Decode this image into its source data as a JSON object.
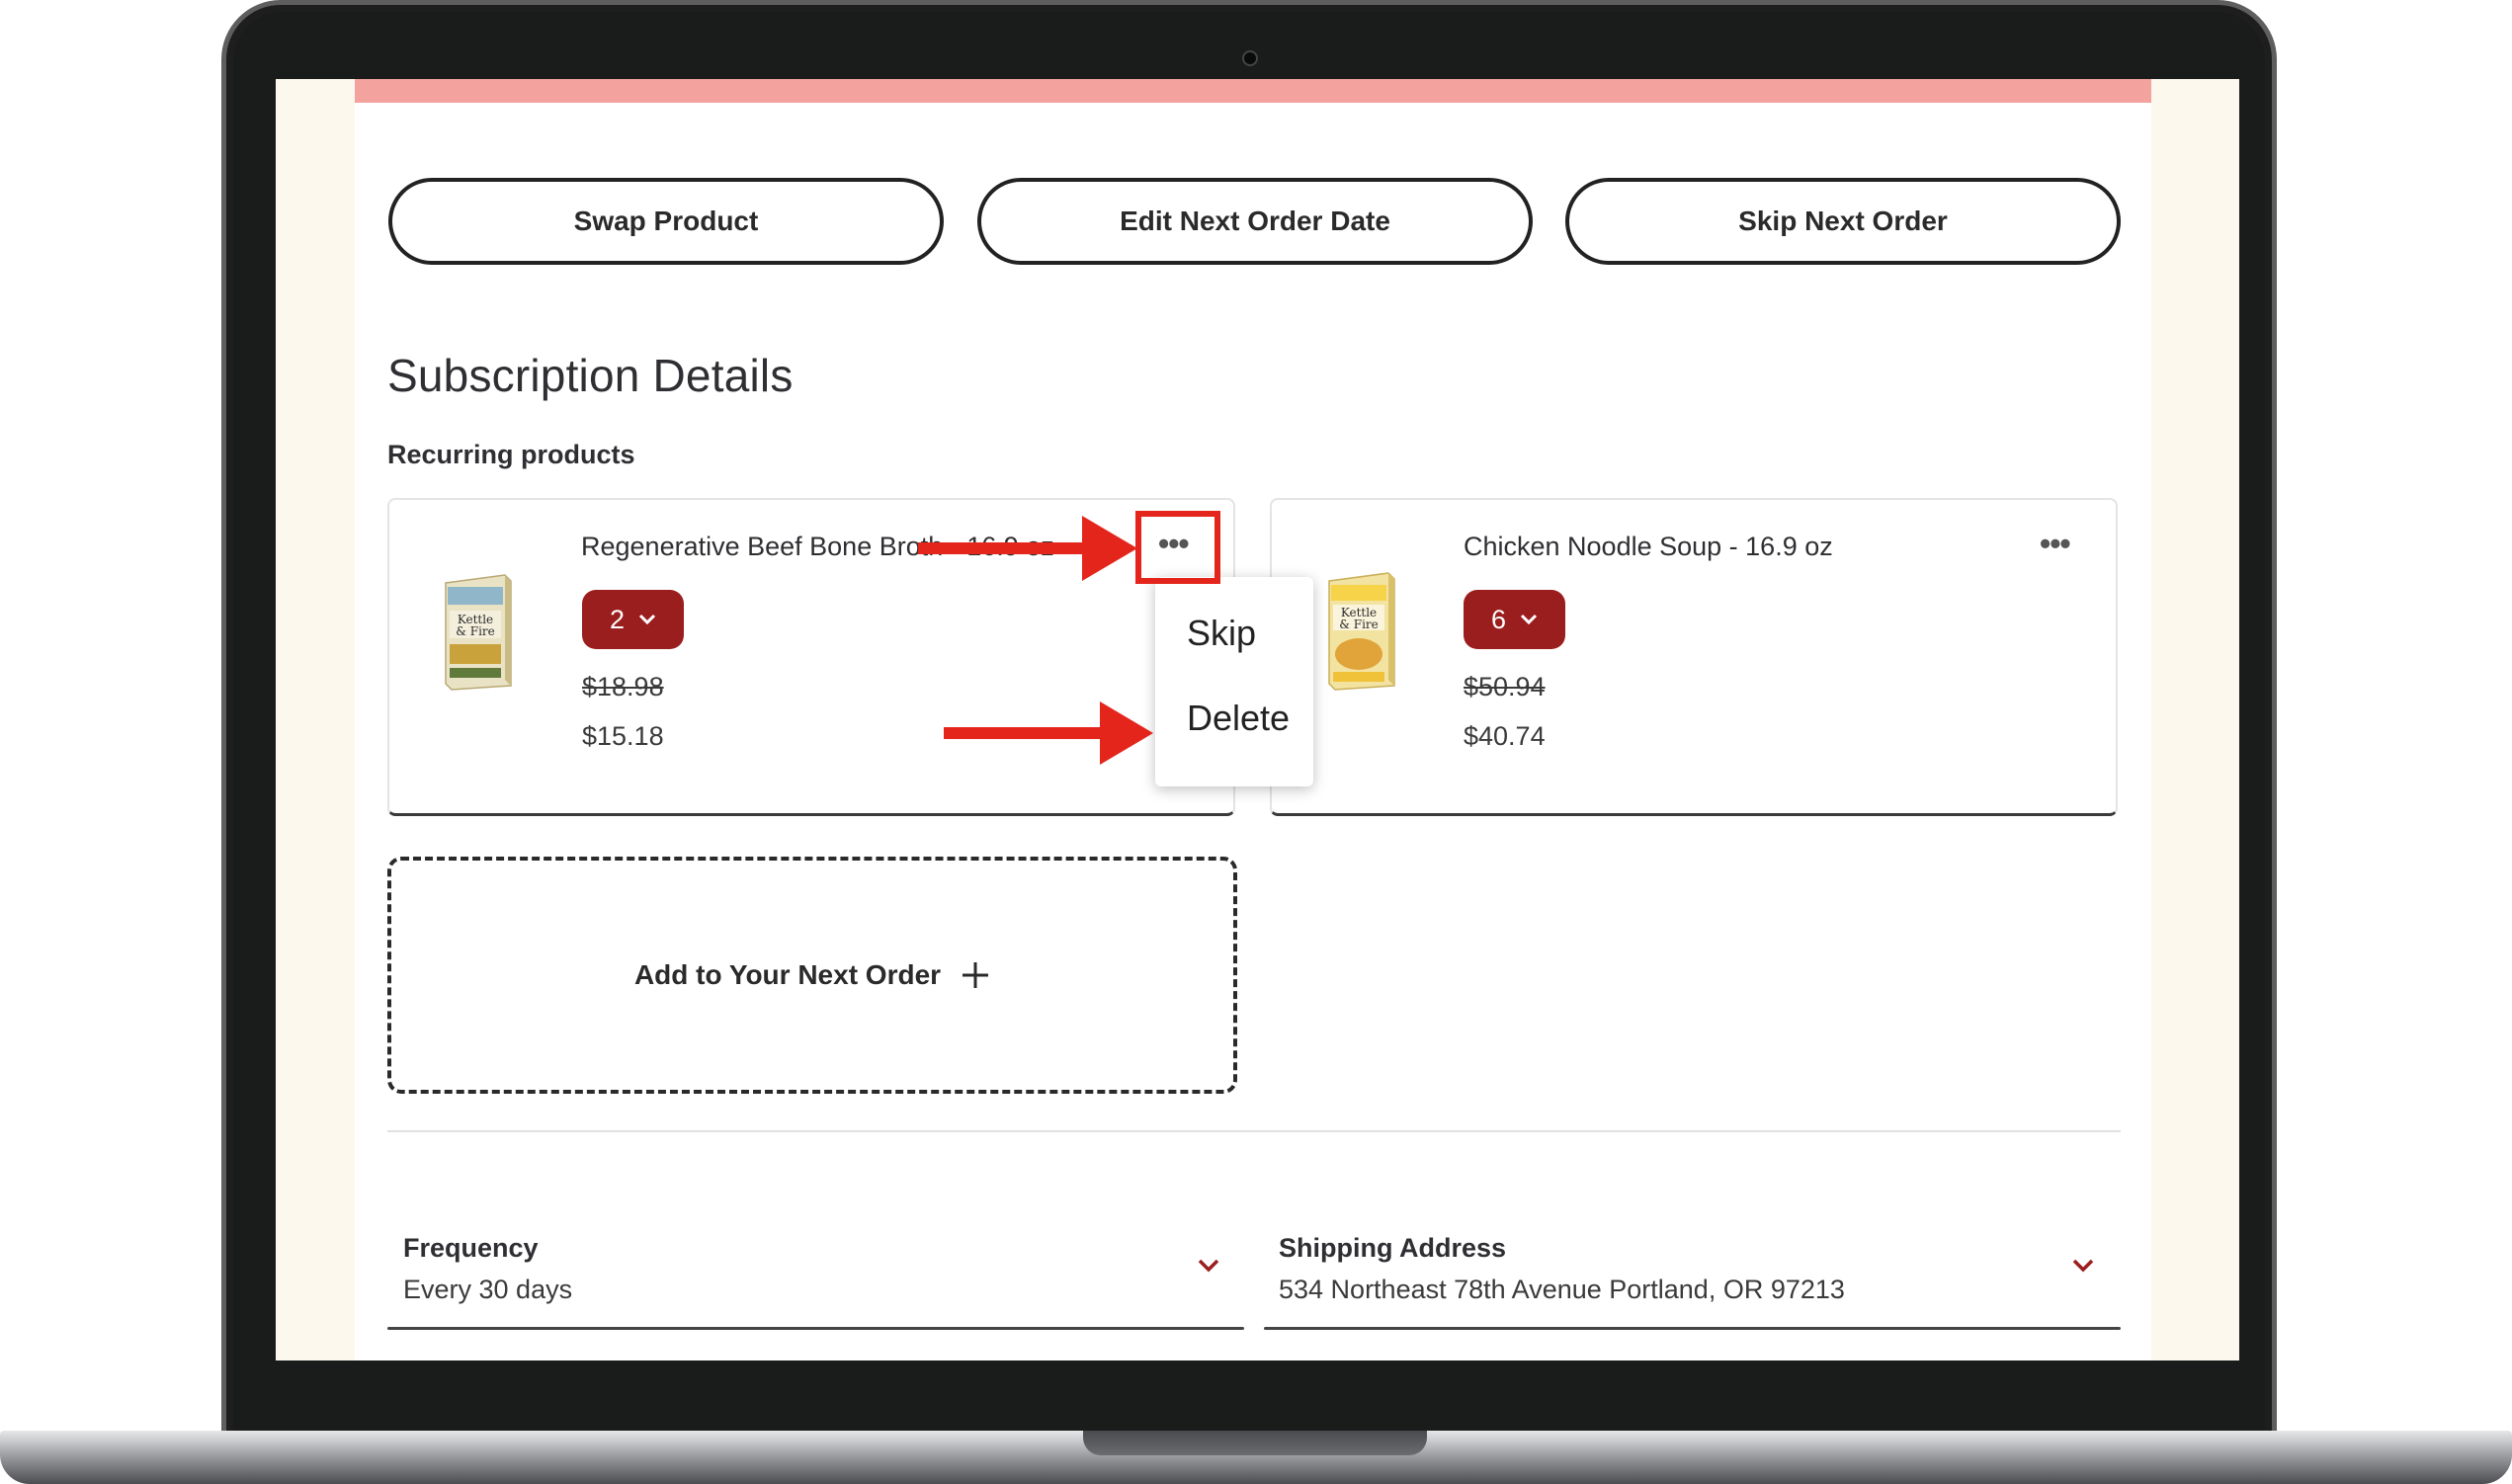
{
  "actions": {
    "swap_label": "Swap Product",
    "edit_date_label": "Edit Next Order Date",
    "skip_order_label": "Skip Next Order"
  },
  "section": {
    "title": "Subscription Details",
    "recurring_label": "Recurring products"
  },
  "products": [
    {
      "name": "Regenerative Beef Bone Broth - 16.9 oz",
      "quantity": "2",
      "original_price": "$18.98",
      "price": "$15.18"
    },
    {
      "name": "Chicken Noodle Soup - 16.9 oz",
      "quantity": "6",
      "original_price": "$50.94",
      "price": "$40.74"
    }
  ],
  "context_menu": {
    "skip": "Skip",
    "delete": "Delete"
  },
  "add_order": {
    "label": "Add to Your Next Order"
  },
  "frequency": {
    "label": "Frequency",
    "value": "Every 30 days"
  },
  "shipping": {
    "label": "Shipping Address",
    "value": "534 Northeast 78th Avenue Portland, OR 97213"
  },
  "colors": {
    "accent": "#9b1e1e",
    "annotation": "#e4251b",
    "top_band": "#f3a29d",
    "screen_bg": "#fdf8ee"
  },
  "icons": {
    "more": "more-horizontal-icon",
    "chevron": "chevron-down-icon",
    "plus": "plus-icon"
  }
}
